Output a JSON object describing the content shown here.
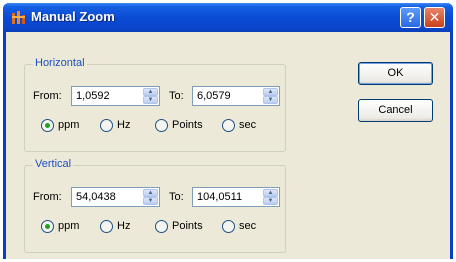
{
  "window": {
    "title": "Manual Zoom",
    "help_glyph": "?",
    "close_glyph": "✕"
  },
  "horizontal": {
    "legend": "Horizontal",
    "from_label": "From:",
    "from_value": "1,0592",
    "to_label": "To:",
    "to_value": "6,0579",
    "units": [
      "ppm",
      "Hz",
      "Points",
      "sec"
    ],
    "selected_unit": "ppm"
  },
  "vertical": {
    "legend": "Vertical",
    "from_label": "From:",
    "from_value": "54,0438",
    "to_label": "To:",
    "to_value": "104,0511",
    "units": [
      "ppm",
      "Hz",
      "Points",
      "sec"
    ],
    "selected_unit": "ppm"
  },
  "buttons": {
    "ok": "OK",
    "cancel": "Cancel"
  },
  "icons": {
    "app": "app-logo-icon",
    "spin_up": "spin-up-arrow-icon",
    "spin_down": "spin-down-arrow-icon"
  },
  "colors": {
    "titlebar": "#0a4bd5",
    "dialog_bg": "#ece9d8",
    "group_legend": "#1c50c2",
    "radio_dot": "#21a121",
    "close_button": "#c8411c"
  }
}
